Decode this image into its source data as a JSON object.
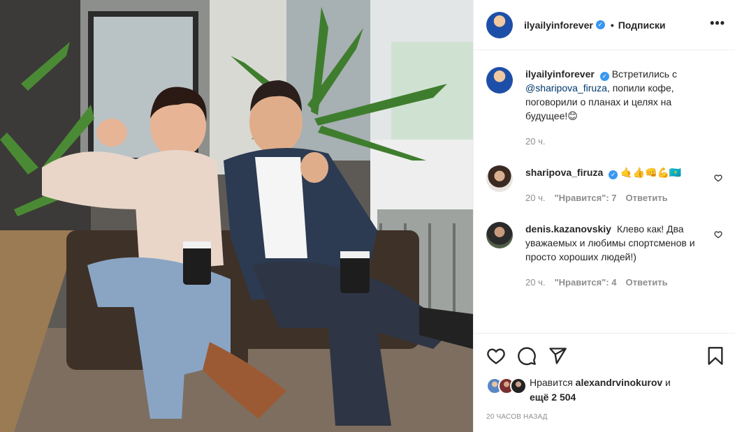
{
  "post": {
    "author": "ilyailyinforever",
    "follow_label": "Подписки",
    "dot": "•",
    "more_label": "•••",
    "verified_glyph": "✓"
  },
  "caption": {
    "author": "ilyailyinforever",
    "text_before": "Встретились с ",
    "mention": "@sharipova_firuza",
    "text_after": ", попили кофе, поговорили о планах и целях на будущее!😊",
    "time": "20 ч."
  },
  "comments": [
    {
      "author": "sharipova_firuza",
      "text": "🤙👍👊💪🇰🇿",
      "time": "20 ч.",
      "likes_label": "\"Нравится\": 7",
      "reply_label": "Ответить"
    },
    {
      "author": "denis.kazanovskiy",
      "text": "Клево как! Два уважаемых и любимы спортсменов и просто хороших людей!)",
      "time": "20 ч.",
      "likes_label": "\"Нравится\": 4",
      "reply_label": "Ответить"
    }
  ],
  "likes": {
    "prefix": "Нравится ",
    "user": "alexandrvinokurov",
    "mid": " и",
    "count_label": "ещё 2 504"
  },
  "posted_ago": "20 часов назад",
  "icons": [
    "heart-icon",
    "comment-icon",
    "share-icon",
    "bookmark-icon",
    "more-icon",
    "verified-icon"
  ],
  "colors": {
    "link": "#00376b",
    "verified": "#3897f0",
    "muted": "#8e8e8e",
    "text": "#262626"
  }
}
